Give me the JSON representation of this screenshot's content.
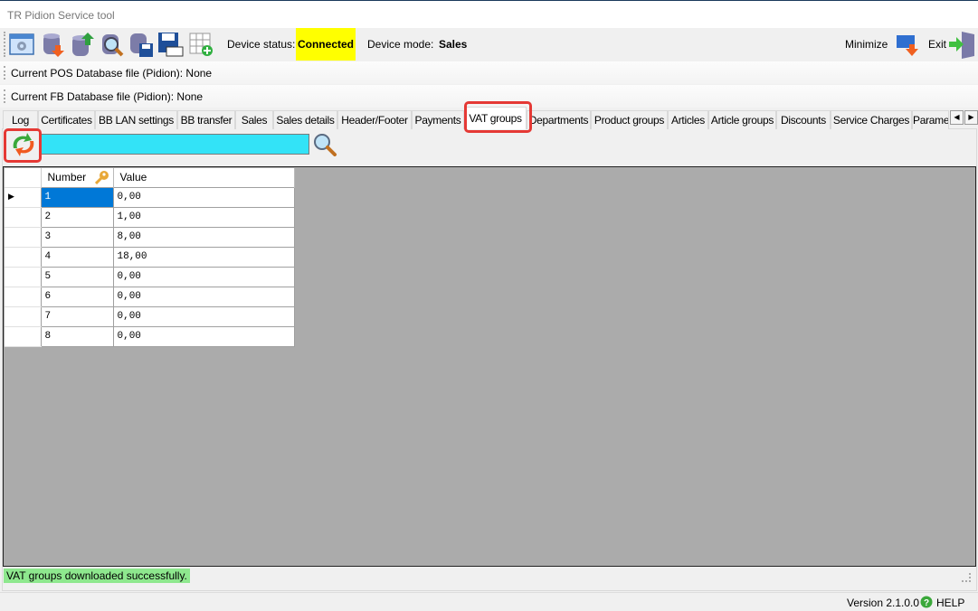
{
  "window": {
    "title": "TR Pidion Service tool"
  },
  "toolbar": {
    "icons": [
      "settings-window-icon",
      "database-download-icon",
      "database-upload-icon",
      "database-search-icon",
      "database-save-icon",
      "save-file-icon",
      "add-grid-icon"
    ],
    "device_status_label": "Device status:",
    "device_status": "Connected",
    "device_status_color": "#ffff00",
    "device_mode_label": "Device mode:",
    "device_mode": "Sales",
    "minimize": "Minimize",
    "exit": "Exit"
  },
  "info": {
    "pos_db": "Current POS Database file (Pidion): None",
    "fb_db": "Current FB Database file (Pidion): None"
  },
  "tabs": [
    "Log",
    "Certificates",
    "BB LAN settings",
    "BB transfer",
    "Sales",
    "Sales details",
    "Header/Footer",
    "Payments",
    "VAT groups",
    "Departments",
    "Product groups",
    "Articles",
    "Article groups",
    "Discounts",
    "Service Charges",
    "Parame"
  ],
  "selected_tab": "VAT groups",
  "search": {
    "value": ""
  },
  "grid": {
    "columns": [
      "Number",
      "Value"
    ],
    "rows": [
      [
        "1",
        "0,00"
      ],
      [
        "2",
        "1,00"
      ],
      [
        "3",
        "8,00"
      ],
      [
        "4",
        "18,00"
      ],
      [
        "5",
        "0,00"
      ],
      [
        "6",
        "0,00"
      ],
      [
        "7",
        "0,00"
      ],
      [
        "8",
        "0,00"
      ]
    ]
  },
  "status_message": "VAT groups downloaded successfully.",
  "footer": {
    "version": "Version 2.1.0.0",
    "help": "HELP"
  }
}
